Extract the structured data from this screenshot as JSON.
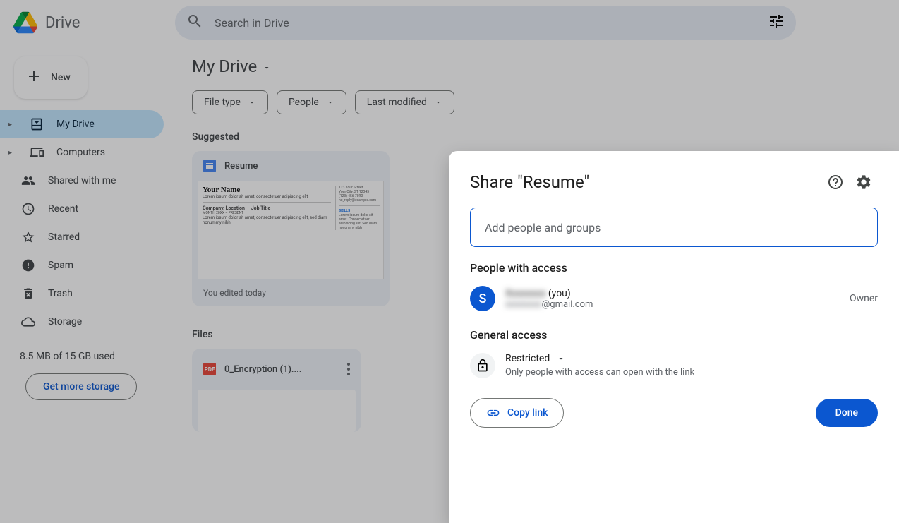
{
  "header": {
    "app_name": "Drive",
    "search_placeholder": "Search in Drive"
  },
  "sidebar": {
    "new_button": "New",
    "items": [
      {
        "label": "My Drive",
        "icon": "my-drive-icon",
        "active": true,
        "expandable": true
      },
      {
        "label": "Computers",
        "icon": "computers-icon",
        "expandable": true
      },
      {
        "label": "Shared with me",
        "icon": "shared-icon"
      },
      {
        "label": "Recent",
        "icon": "recent-icon"
      },
      {
        "label": "Starred",
        "icon": "star-icon"
      },
      {
        "label": "Spam",
        "icon": "spam-icon"
      },
      {
        "label": "Trash",
        "icon": "trash-icon"
      },
      {
        "label": "Storage",
        "icon": "storage-icon"
      }
    ],
    "storage_used": "8.5 MB of 15 GB used",
    "storage_cta": "Get more storage"
  },
  "content": {
    "title": "My Drive",
    "filters": [
      {
        "label": "File type"
      },
      {
        "label": "People"
      },
      {
        "label": "Last modified"
      }
    ],
    "suggested_title": "Suggested",
    "suggested": {
      "name": "Resume",
      "preview": {
        "heading": "Your Name",
        "sub": "Lorem ipsum dolor sit amet, consectetuer adipiscing elit",
        "job": "Company, Location — Job Title",
        "dates": "MONTH 20XX – PRESENT",
        "body": "Lorem ipsum dolor sit amet, consectetuer adipiscing elit, sed diam nonummy nibh.",
        "addr": "123 Your Street\nYour City, ST 12345\n(123) 456-7890\nno_reply@example.com",
        "skills": "SKILLS",
        "skills_body": "Lorem ipsum dolor sit amet. Consectetuer adipiscing elit. Sed diam nonummy nibh"
      },
      "subtitle": "You edited today"
    },
    "files_title": "Files",
    "files": [
      {
        "name": "0_Encryption (1)....",
        "type": "PDF"
      }
    ]
  },
  "dialog": {
    "title": "Share \"Resume\"",
    "input_placeholder": "Add people and groups",
    "people_section": "People with access",
    "person": {
      "initial": "S",
      "name_hidden": "Xxxxxxxx",
      "name_suffix": " (you)",
      "email_hidden": "xxxxxxxx",
      "email_suffix": "@gmail.com",
      "role": "Owner"
    },
    "general_section": "General access",
    "ga": {
      "level": "Restricted",
      "desc": "Only people with access can open with the link"
    },
    "copy_link": "Copy link",
    "done": "Done"
  }
}
